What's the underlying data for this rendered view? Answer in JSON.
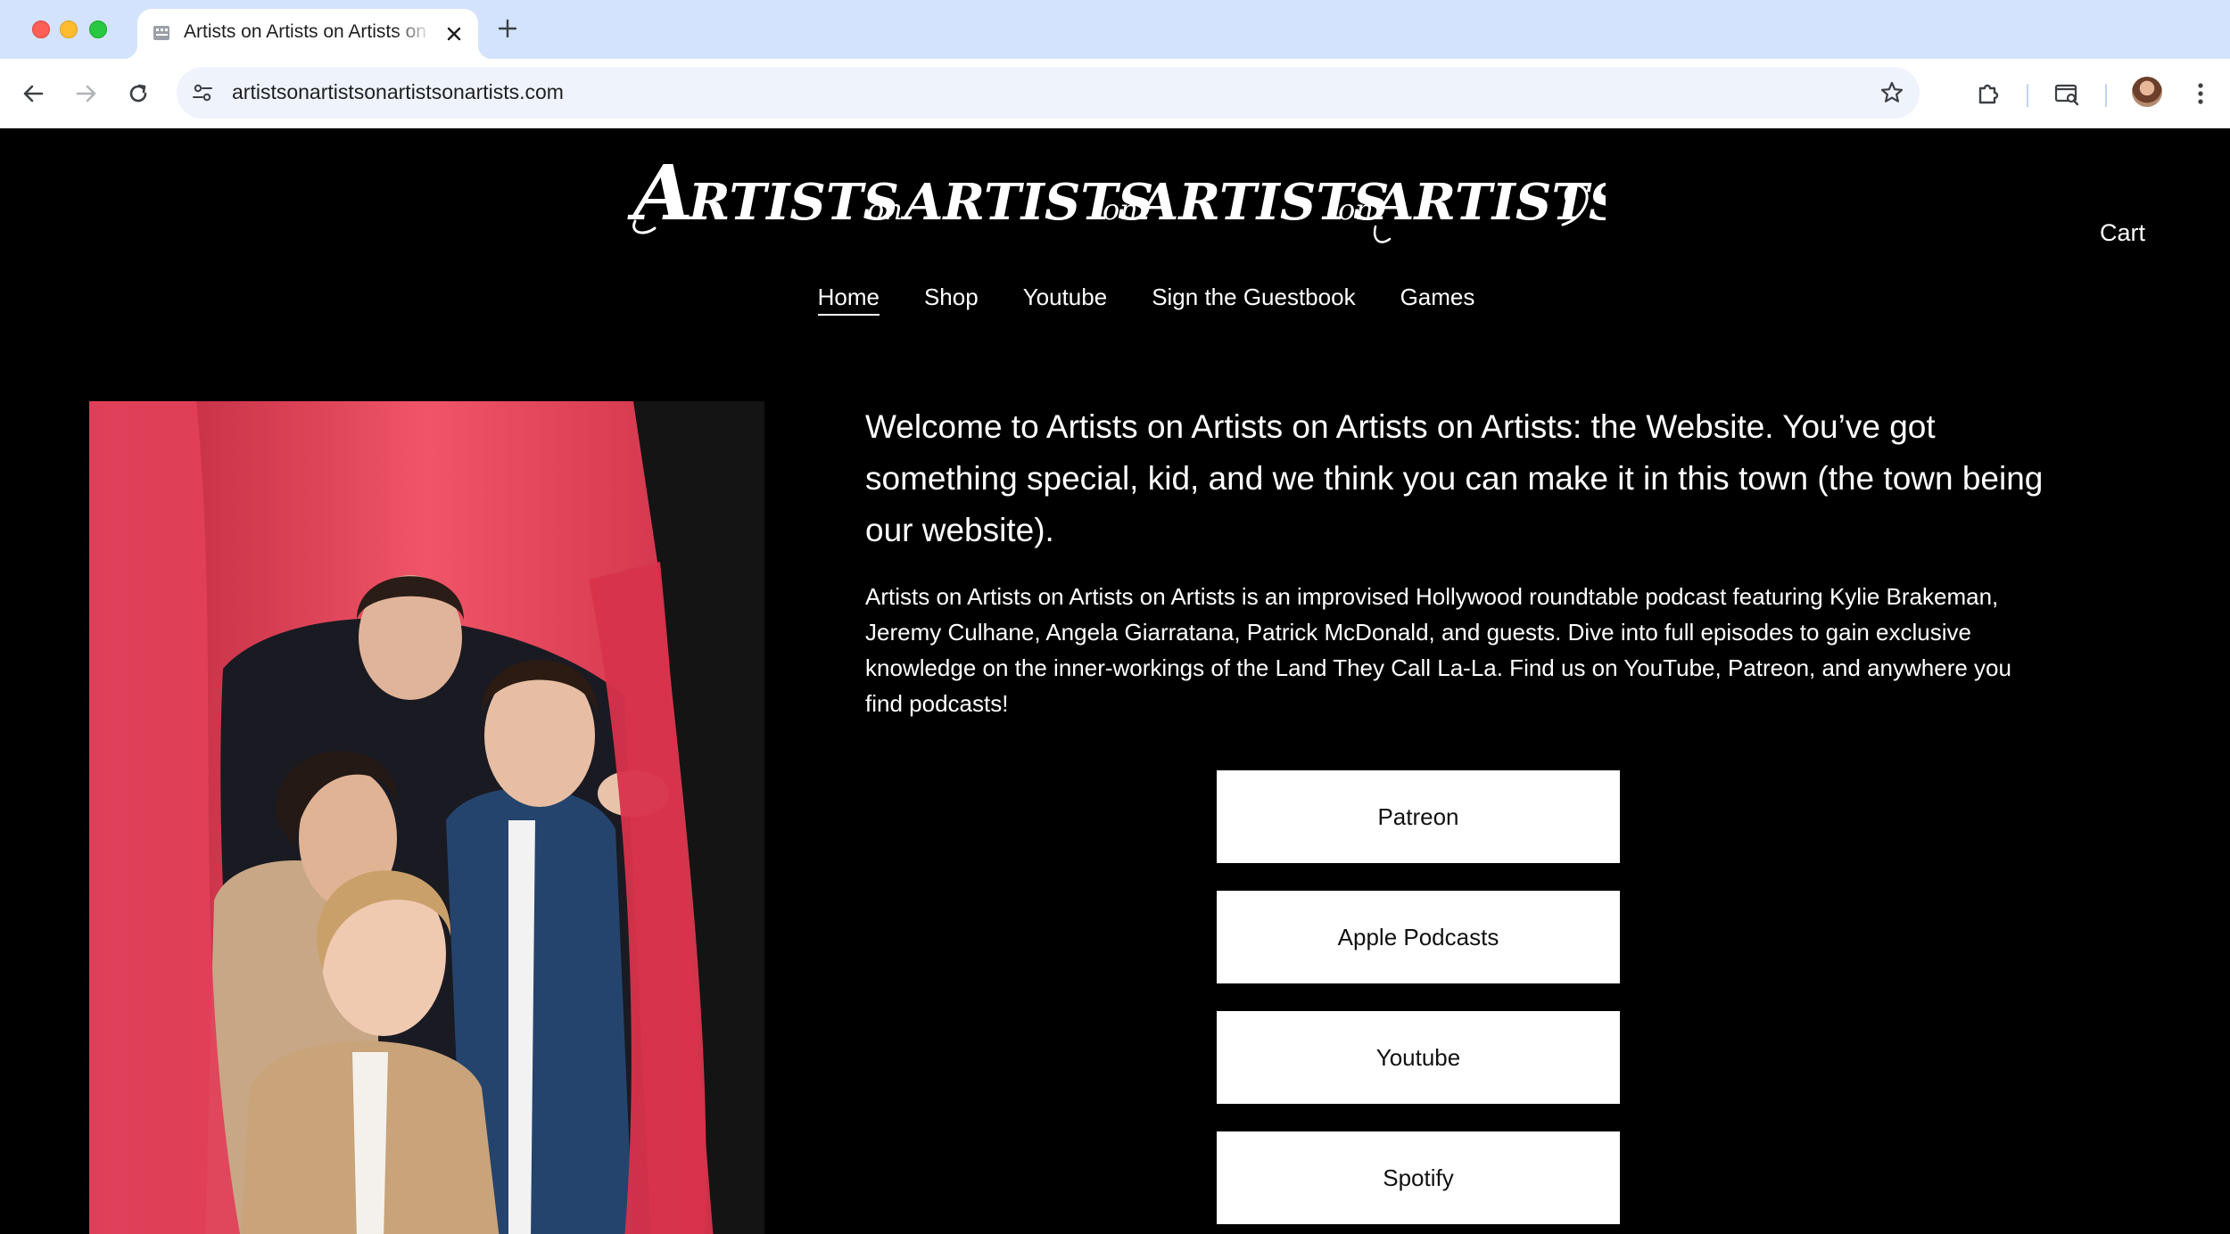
{
  "browser": {
    "tab_title": "Artists on Artists on Artists on Artists",
    "url": "artistsonartistsonartistsonartists.com"
  },
  "site": {
    "logo_text": "Artists on Artists on Artists on Artists",
    "cart_label": "Cart",
    "nav": [
      {
        "label": "Home",
        "active": true
      },
      {
        "label": "Shop",
        "active": false
      },
      {
        "label": "Youtube",
        "active": false
      },
      {
        "label": "Sign the Guestbook",
        "active": false
      },
      {
        "label": "Games",
        "active": false
      }
    ]
  },
  "main": {
    "heading": "Welcome to Artists on Artists on Artists on Artists: the Website. You’ve got something special, kid, and we think you can make it in this town (the town being our website).",
    "body": "Artists on Artists on Artists on Artists is an improvised Hollywood roundtable podcast featuring Kylie Brakeman, Jeremy Culhane, Angela Giarratana, Patrick McDonald, and guests. Dive into full episodes to gain exclusive knowledge on the inner-workings of the Land They Call La-La. Find us on YouTube, Patreon, and anywhere you find podcasts!",
    "buttons": [
      "Patreon",
      "Apple Podcasts",
      "Youtube",
      "Spotify"
    ]
  },
  "colors": {
    "page_background": "#000000",
    "curtain": "#e33d55",
    "button_background": "#ffffff"
  }
}
